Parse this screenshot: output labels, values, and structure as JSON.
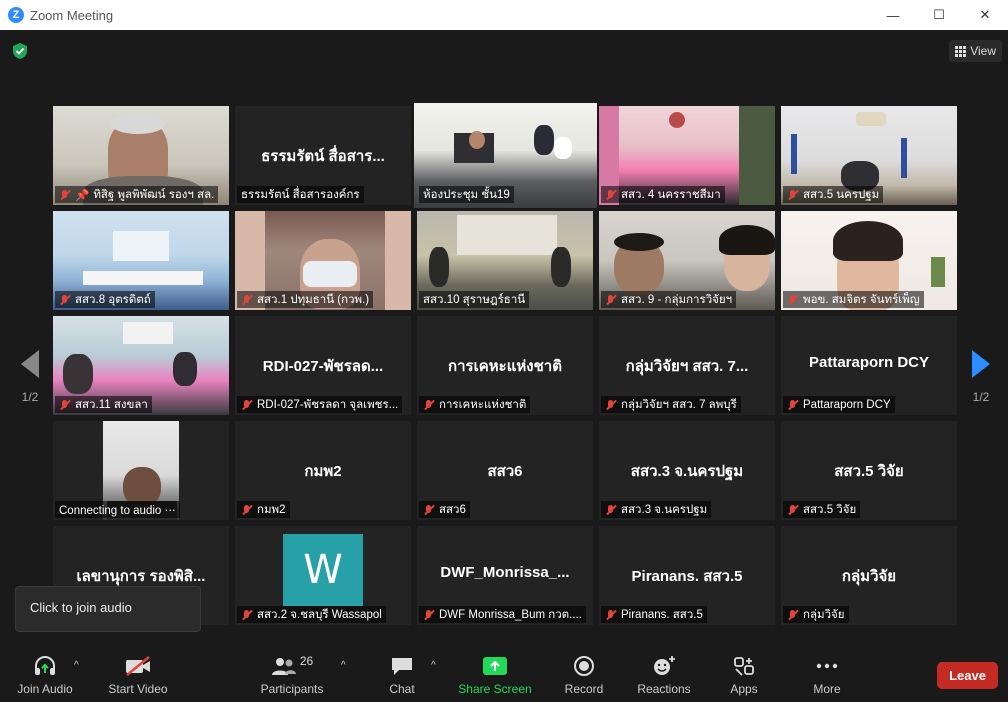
{
  "window": {
    "title": "Zoom Meeting",
    "minimize": "—",
    "maximize": "☐",
    "close": "✕"
  },
  "view_button": {
    "label": "View"
  },
  "pager": {
    "left": "1/2",
    "right": "1/2"
  },
  "tiles": [
    {
      "name": "ทิสิฐ พูลพิพัฒน์ รองฯ สล."
    },
    {
      "big": "ธรรมรัตน์ สื่อสาร...",
      "name": "ธรรมรัตน์ สื่อสารองค์กร"
    },
    {
      "name": "ห้องประชุม ชั้น19"
    },
    {
      "name": "สสว. 4 นครราชสีมา"
    },
    {
      "name": "สสว.5 นครปฐม"
    },
    {
      "name": "สสว.8 อุตรดิตถ์"
    },
    {
      "name": "สสว.1 ปทุมธานี (กวพ.)"
    },
    {
      "name": "สสว.10 สุราษฎร์ธานี"
    },
    {
      "name": "สสว. 9 - กลุ่มการวิจัยฯ"
    },
    {
      "name": "พอข. สมจิตร จันทร์เพ็ญ"
    },
    {
      "name": "สสว.11 สงขลา"
    },
    {
      "big": "RDI-027-พัชรลด...",
      "name": "RDI-027-พัชรลดา จุลเพชร..."
    },
    {
      "big": "การเคหะแห่งชาติ",
      "name": "การเคหะแห่งชาติ"
    },
    {
      "big": "กลุ่มวิจัยฯ สสว. 7...",
      "name": "กลุ่มวิจัยฯ สสว. 7 ลพบุรี"
    },
    {
      "big": "Pattaraporn DCY",
      "name": "Pattaraporn DCY"
    },
    {
      "name": "Connecting to audio ⋯"
    },
    {
      "big": "กมพ2",
      "name": "กมพ2"
    },
    {
      "big": "สสว6",
      "name": "สสว6"
    },
    {
      "big": "สสว.3 จ.นครปฐม",
      "name": "สสว.3 จ.นครปฐม"
    },
    {
      "big": "สสว.5 วิจัย",
      "name": "สสว.5 วิจัย"
    },
    {
      "big": "เลขานุการ รองพิสิ...",
      "name": ""
    },
    {
      "avatar": "W",
      "name": "สสว.2 จ.ชลบุรี Wassapol"
    },
    {
      "big": "DWF_Monrissa_...",
      "name": "DWF Monrissa_Bum กวต...."
    },
    {
      "big": "Piranans. สสว.5",
      "name": "Piranans. สสว.5"
    },
    {
      "big": "กลุ่มวิจัย",
      "name": "กลุ่มวิจัย"
    }
  ],
  "tooltip": {
    "text": "Click to join audio"
  },
  "toolbar": {
    "join_audio": "Join Audio",
    "start_video": "Start Video",
    "participants": "Participants",
    "participant_count": "26",
    "chat": "Chat",
    "share_screen": "Share Screen",
    "record": "Record",
    "reactions": "Reactions",
    "apps": "Apps",
    "more": "More",
    "leave": "Leave"
  },
  "colors": {
    "accent": "#2d8cff",
    "share_green": "#23d959",
    "leave_red": "#c42b25",
    "active_speaker": "#cfe55f",
    "muted_red": "#e0443b"
  }
}
